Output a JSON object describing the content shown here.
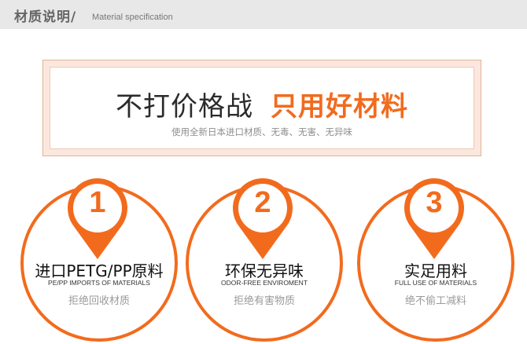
{
  "header": {
    "title": "材质说明/",
    "subtitle": "Material specification"
  },
  "banner": {
    "main_black": "不打价格战",
    "main_orange": "只用好材料",
    "sub": "使用全新日本进口材质、无毒、无害、无异味"
  },
  "colors": {
    "accent": "#f26b1d",
    "header_bg": "#e8e8e8",
    "banner_bg": "#fbe7dd"
  },
  "features": [
    {
      "number": "1",
      "title": "进口PETG/PP原料",
      "en": "PE/PP IMPORTS OF MATERIALS",
      "desc": "拒绝回收材质"
    },
    {
      "number": "2",
      "title": "环保无异味",
      "en": "ODOR-FREE ENVIROMENT",
      "desc": "拒绝有害物质"
    },
    {
      "number": "3",
      "title": "实足用料",
      "en": "FULL USE OF MATERIALS",
      "desc": "绝不偷工减料"
    }
  ]
}
